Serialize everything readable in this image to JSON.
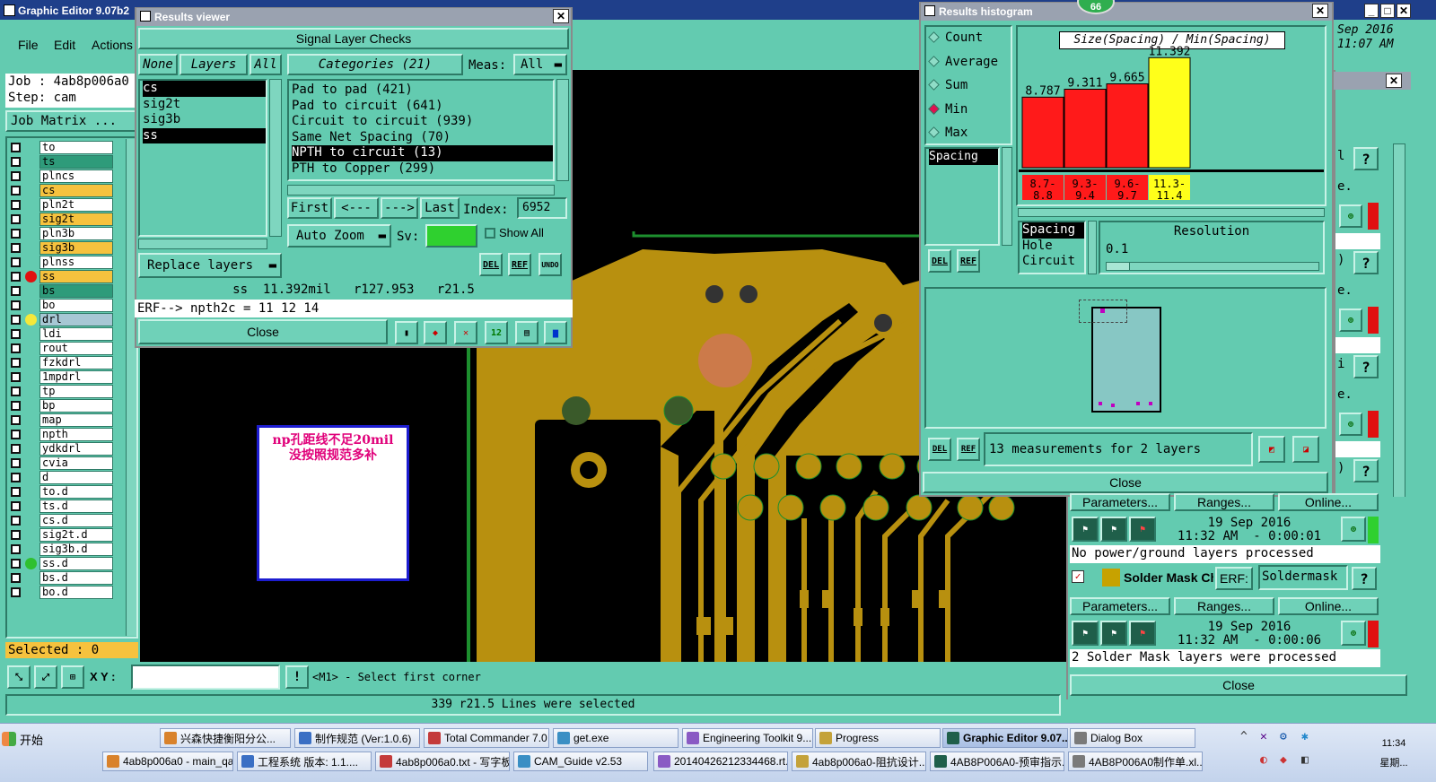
{
  "main_window": {
    "title": "Graphic Editor 9.07b2",
    "menu": [
      "File",
      "Edit",
      "Actions"
    ],
    "job_label": "Job : 4ab8p006a0",
    "step_label": "Step: cam",
    "job_matrix_button": "Job Matrix ...",
    "selected_label": "Selected : 0",
    "xy_label": "X Y :",
    "prompt_text": "<M1> - Select first corner",
    "status_text": "339 r21.5 Lines were selected",
    "clock_date_fragment": "Sep 2016",
    "clock_time_fragment": "11:07 AM",
    "badge": "66"
  },
  "layers": [
    {
      "name": "to",
      "color": "#ffffff",
      "marker": ""
    },
    {
      "name": "ts",
      "color": "#2e9b7a",
      "marker": ""
    },
    {
      "name": "plncs",
      "color": "#ffffff",
      "marker": ""
    },
    {
      "name": "cs",
      "color": "#f6c23e",
      "marker": ""
    },
    {
      "name": "pln2t",
      "color": "#ffffff",
      "marker": ""
    },
    {
      "name": "sig2t",
      "color": "#f6c23e",
      "marker": ""
    },
    {
      "name": "pln3b",
      "color": "#ffffff",
      "marker": ""
    },
    {
      "name": "sig3b",
      "color": "#f6c23e",
      "marker": ""
    },
    {
      "name": "plnss",
      "color": "#ffffff",
      "marker": ""
    },
    {
      "name": "ss",
      "color": "#f6c23e",
      "marker": "#e01010"
    },
    {
      "name": "bs",
      "color": "#2e9b7a",
      "marker": ""
    },
    {
      "name": "bo",
      "color": "#ffffff",
      "marker": ""
    },
    {
      "name": "drl",
      "color": "#a7c7d4",
      "marker": "#f4e83a"
    },
    {
      "name": "ldi",
      "color": "#ffffff",
      "marker": ""
    },
    {
      "name": "rout",
      "color": "#ffffff",
      "marker": ""
    },
    {
      "name": "fzkdrl",
      "color": "#ffffff",
      "marker": ""
    },
    {
      "name": "1mpdrl",
      "color": "#ffffff",
      "marker": ""
    },
    {
      "name": "tp",
      "color": "#ffffff",
      "marker": ""
    },
    {
      "name": "bp",
      "color": "#ffffff",
      "marker": ""
    },
    {
      "name": "map",
      "color": "#ffffff",
      "marker": ""
    },
    {
      "name": "npth",
      "color": "#ffffff",
      "marker": ""
    },
    {
      "name": "ydkdrl",
      "color": "#ffffff",
      "marker": ""
    },
    {
      "name": "cvia",
      "color": "#ffffff",
      "marker": ""
    },
    {
      "name": "d",
      "color": "#ffffff",
      "marker": ""
    },
    {
      "name": "to.d",
      "color": "#ffffff",
      "marker": ""
    },
    {
      "name": "ts.d",
      "color": "#ffffff",
      "marker": ""
    },
    {
      "name": "cs.d",
      "color": "#ffffff",
      "marker": ""
    },
    {
      "name": "sig2t.d",
      "color": "#ffffff",
      "marker": ""
    },
    {
      "name": "sig3b.d",
      "color": "#ffffff",
      "marker": ""
    },
    {
      "name": "ss.d",
      "color": "#ffffff",
      "marker": "#2fc02f"
    },
    {
      "name": "bs.d",
      "color": "#ffffff",
      "marker": ""
    },
    {
      "name": "bo.d",
      "color": "#ffffff",
      "marker": ""
    }
  ],
  "results_viewer": {
    "title": "Results viewer",
    "header": "Signal Layer Checks",
    "none_btn": "None",
    "layers_btn": "Layers",
    "all_btn": "All",
    "categories_label": "Categories (21)",
    "meas_label": "Meas:",
    "meas_value": "All",
    "layer_list": [
      "cs",
      "sig2t",
      "sig3b",
      "ss"
    ],
    "categories": [
      "Pad to pad (421)",
      "Pad to circuit (641)",
      "Circuit to circuit (939)",
      "Same Net Spacing (70)",
      "NPTH to circuit (13)",
      "PTH to Copper (299)"
    ],
    "nav_first": "First",
    "nav_prev": "<---",
    "nav_next": "--->",
    "nav_last": "Last",
    "index_label": "Index:",
    "index_value": "6952",
    "auto_zoom": "Auto Zoom",
    "sv_label": "Sv:",
    "show_all": "Show All",
    "replace_layers": "Replace layers",
    "del_label": "DEL",
    "ref_label": "REF",
    "undo_label": "UNDO",
    "measure_line": "ss  11.392mil   r127.953   r21.5",
    "erf_line": "ERF--> npth2c = 11 12 14",
    "close": "Close"
  },
  "histogram": {
    "title": "Results histogram",
    "stat_options": [
      "Count",
      "Average",
      "Sum",
      "Min",
      "Max"
    ],
    "selected_stat": "Min",
    "chart_title": "Size(Spacing) / Min(Spacing)",
    "meas_list": [
      "Spacing"
    ],
    "type_list": [
      "Spacing",
      "Hole",
      "Circuit"
    ],
    "resolution_label": "Resolution",
    "resolution_value": "0.1",
    "summary": "13 measurements for 2 layers",
    "close": "Close",
    "del_label": "DEL",
    "ref_label": "REF"
  },
  "chart_data": {
    "type": "bar",
    "title": "Size(Spacing) / Min(Spacing)",
    "categories": [
      "8.7-8.8",
      "9.3-9.4",
      "9.6-9.7",
      "11.3-11.4"
    ],
    "values": [
      8.787,
      9.311,
      9.665,
      11.392
    ],
    "value_labels": [
      "8.787",
      "9.311",
      "9.665",
      "11.392"
    ],
    "bin_labels": [
      [
        "8.7-",
        "8.8"
      ],
      [
        "9.3-",
        "9.4"
      ],
      [
        "9.6-",
        "9.7"
      ],
      [
        "11.3-",
        "11.4"
      ]
    ],
    "colors": [
      "#ff1a1a",
      "#ff1a1a",
      "#ff1a1a",
      "#ffff1a"
    ],
    "ylim": [
      0,
      12
    ]
  },
  "checklist": {
    "params_btn": "Parameters...",
    "ranges_btn": "Ranges...",
    "online_btn": "Online...",
    "run1_date": "19 Sep 2016",
    "run1_time": "11:32 AM  - 0:00:01",
    "run1_msg": "No power/ground layers processed",
    "solder_label": "Solder Mask Ch",
    "erf_btn": "ERF:",
    "erf_value": "Soldermask",
    "run2_date": "19 Sep 2016",
    "run2_time": "11:32 AM  - 0:00:06",
    "run2_msg": "2 Solder Mask layers were processed",
    "close": "Close",
    "help": "?",
    "partial_letters": [
      "l",
      "e.",
      ")",
      "e.",
      "i",
      "e.",
      ")"
    ]
  },
  "canvas": {
    "note_line1": "np孔距线不足20mil",
    "note_line2": "没按照规范多补"
  },
  "taskbar": {
    "start": "开始",
    "row1": [
      "兴森快捷衡阳分公...",
      "制作规范 (Ver:1.0.6)",
      "Total Commander 7.0 ...",
      "get.exe",
      "Engineering Toolkit 9....",
      "Progress",
      "Graphic Editor 9.07...",
      "Dialog Box"
    ],
    "row2": [
      "4ab8p006a0 - main_qa",
      "工程系统  版本: 1.1....",
      "4ab8p006a0.txt - 写字板",
      "CAM_Guide v2.53",
      "20140426212334468.rt...",
      "4ab8p006a0-阻抗设计...",
      "4AB8P006A0-预审指示...",
      "4AB8P006A0制作单.xl..."
    ],
    "clock": "11:34",
    "weekday": "星期..."
  }
}
